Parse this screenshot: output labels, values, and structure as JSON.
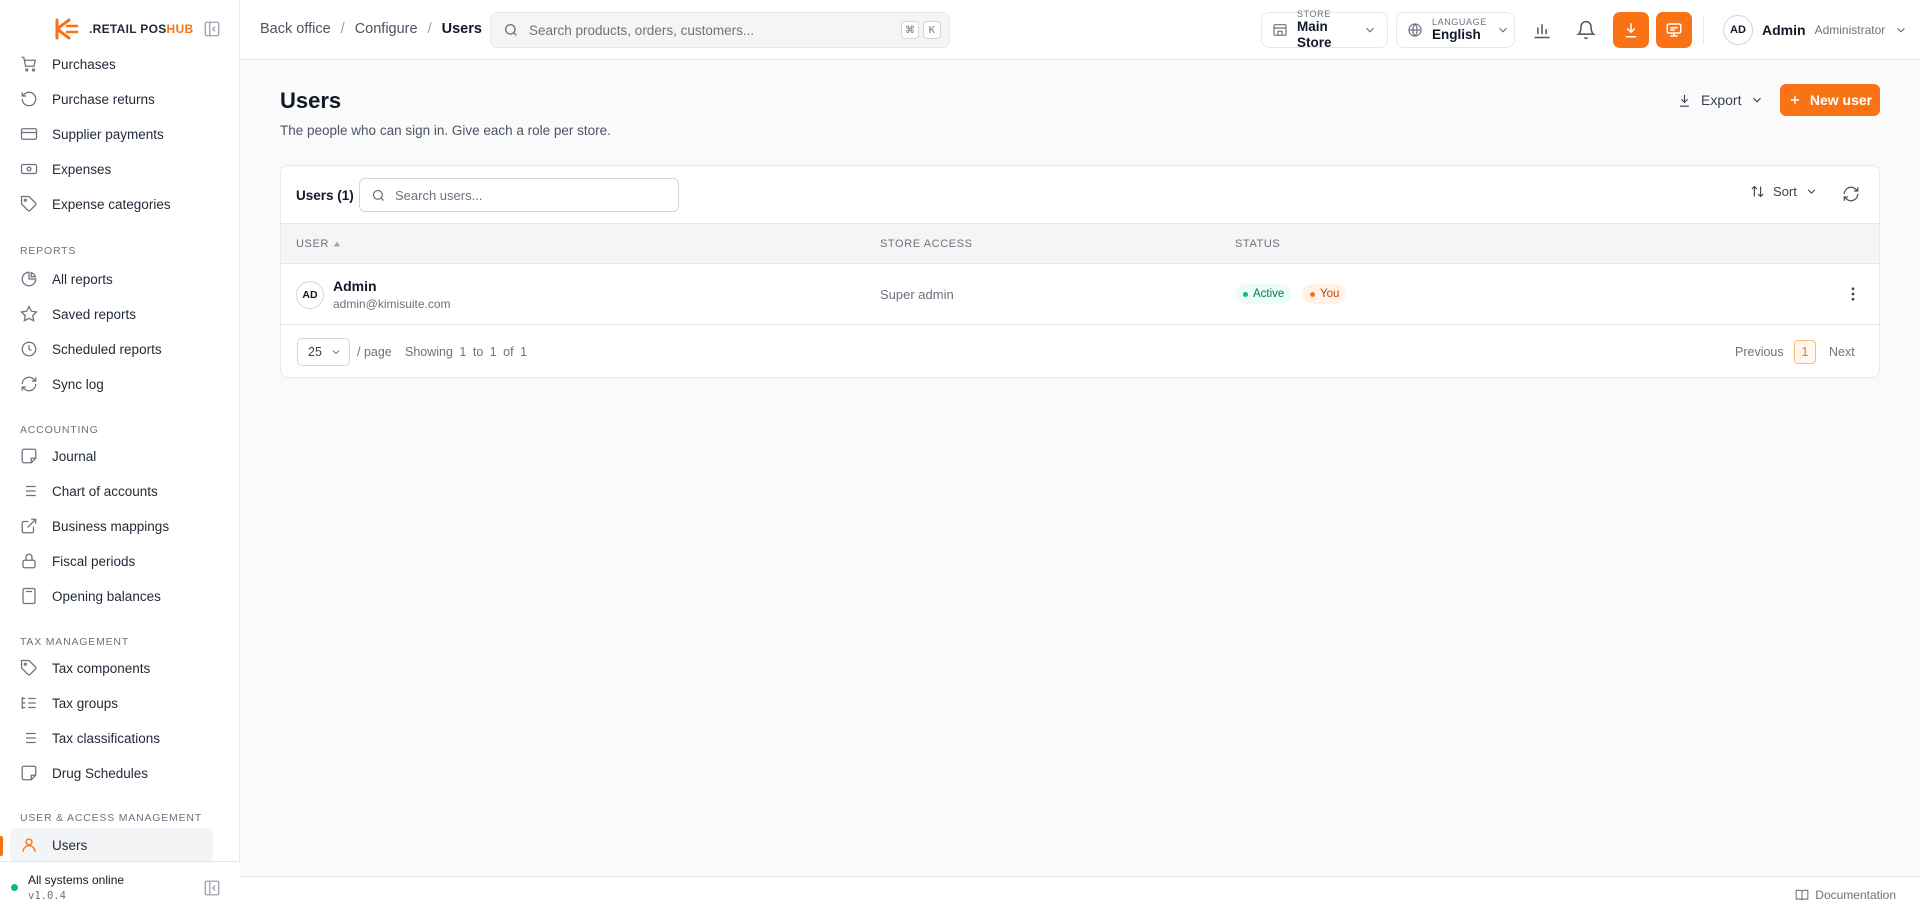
{
  "brand": {
    "name_part1": ".RETAIL POS",
    "name_part2": "HUB"
  },
  "sidebar": {
    "items_top": [
      {
        "label": "Purchases",
        "icon": "cart-icon"
      },
      {
        "label": "Purchase returns",
        "icon": "rotate-ccw-icon"
      },
      {
        "label": "Supplier payments",
        "icon": "credit-card-icon"
      },
      {
        "label": "Expenses",
        "icon": "banknote-icon"
      },
      {
        "label": "Expense categories",
        "icon": "tag-icon"
      }
    ],
    "reports_label": "REPORTS",
    "reports": [
      {
        "label": "All reports",
        "icon": "pie-chart-icon"
      },
      {
        "label": "Saved reports",
        "icon": "star-icon"
      },
      {
        "label": "Scheduled reports",
        "icon": "clock-icon"
      },
      {
        "label": "Sync log",
        "icon": "refresh-icon"
      }
    ],
    "accounting_label": "ACCOUNTING",
    "accounting": [
      {
        "label": "Journal",
        "icon": "sticky-note-icon"
      },
      {
        "label": "Chart of accounts",
        "icon": "list-icon"
      },
      {
        "label": "Business mappings",
        "icon": "external-link-icon"
      },
      {
        "label": "Fiscal periods",
        "icon": "lock-icon"
      },
      {
        "label": "Opening balances",
        "icon": "calculator-icon"
      }
    ],
    "tax_label": "TAX MANAGEMENT",
    "tax": [
      {
        "label": "Tax components",
        "icon": "tag-icon"
      },
      {
        "label": "Tax groups",
        "icon": "list-tree-icon"
      },
      {
        "label": "Tax classifications",
        "icon": "list-icon"
      },
      {
        "label": "Drug Schedules",
        "icon": "sticky-note-icon"
      }
    ],
    "uam_label": "USER & ACCESS MANAGEMENT",
    "uam": [
      {
        "label": "Users",
        "icon": "user-icon",
        "active": true
      }
    ],
    "footer": {
      "status": "All systems online",
      "version": "v1.0.4"
    }
  },
  "topbar": {
    "breadcrumb": [
      "Back office",
      "Configure",
      "Users"
    ],
    "search_placeholder": "Search products, orders, customers...",
    "shortcut_keys": [
      "⌘",
      "K"
    ],
    "store": {
      "label": "STORE",
      "value": "Main Store"
    },
    "language": {
      "label": "LANGUAGE",
      "value": "English"
    },
    "user": {
      "initials": "AD",
      "name": "Admin",
      "role": "Administrator"
    }
  },
  "page": {
    "title": "Users",
    "subtitle": "The people who can sign in. Give each a role per store.",
    "export_label": "Export",
    "new_label": "New user"
  },
  "table": {
    "title": "Users (1)",
    "search_placeholder": "Search users...",
    "sort_label": "Sort",
    "columns": [
      "USER",
      "STORE ACCESS",
      "STATUS"
    ],
    "rows": [
      {
        "initials": "AD",
        "name": "Admin",
        "email": "admin@kimisuite.com",
        "store_access": "Super admin",
        "badges": [
          "Active",
          "You"
        ]
      }
    ],
    "pagination": {
      "per_page": "25",
      "per_page_label": "/ page",
      "showing": "Showing 1 to 1 of 1",
      "prev": "Previous",
      "current": "1",
      "next": "Next"
    }
  },
  "footer": {
    "documentation": "Documentation"
  },
  "colors": {
    "accent": "#f97316",
    "success": "#10b981"
  }
}
